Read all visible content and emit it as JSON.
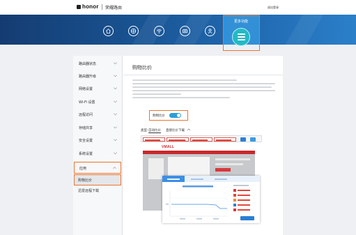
{
  "header": {
    "logo_text": "honor",
    "product_name": "荣耀路由",
    "logout": "退出登录"
  },
  "nav": {
    "tabs": [
      {
        "name": "home",
        "icon": "home-icon"
      },
      {
        "name": "internet",
        "icon": "globe-icon"
      },
      {
        "name": "wifi",
        "icon": "wifi-icon"
      },
      {
        "name": "devices",
        "icon": "router-icon"
      },
      {
        "name": "account",
        "icon": "user-icon"
      }
    ],
    "more": {
      "label": "更多功能",
      "icon": "menu-icon",
      "active": true
    }
  },
  "sidebar": {
    "items": [
      {
        "label": "路由器状态",
        "chevron": "down"
      },
      {
        "label": "路由器升级",
        "chevron": "down"
      },
      {
        "label": "网络设置",
        "chevron": "down"
      },
      {
        "label": "Wi-Fi 设置",
        "chevron": "down"
      },
      {
        "label": "远程访问",
        "chevron": "down"
      },
      {
        "label": "存储共享",
        "chevron": "down"
      },
      {
        "label": "安全设置",
        "chevron": "down"
      },
      {
        "label": "系统设置",
        "chevron": "down"
      },
      {
        "label": "应用",
        "chevron": "up",
        "expanded": true
      },
      {
        "label": "购物比价",
        "selected": true
      },
      {
        "label": "迅雷远程下载"
      }
    ]
  },
  "content": {
    "title": "购物比价",
    "toggle": {
      "label": "购物比价",
      "enabled": true
    },
    "type": {
      "label": "类型:",
      "options": [
        "自动比价",
        "直接比价下载"
      ],
      "selected": "自动比价"
    }
  },
  "preview": {
    "site_logo": "VMALL"
  },
  "colors": {
    "highlight_border": "#e9742f",
    "nav_blue": "#1f66ad",
    "more_circle": "#22b9c6",
    "toggle_on": "#2a9fd8",
    "price_red": "#e0473b"
  }
}
